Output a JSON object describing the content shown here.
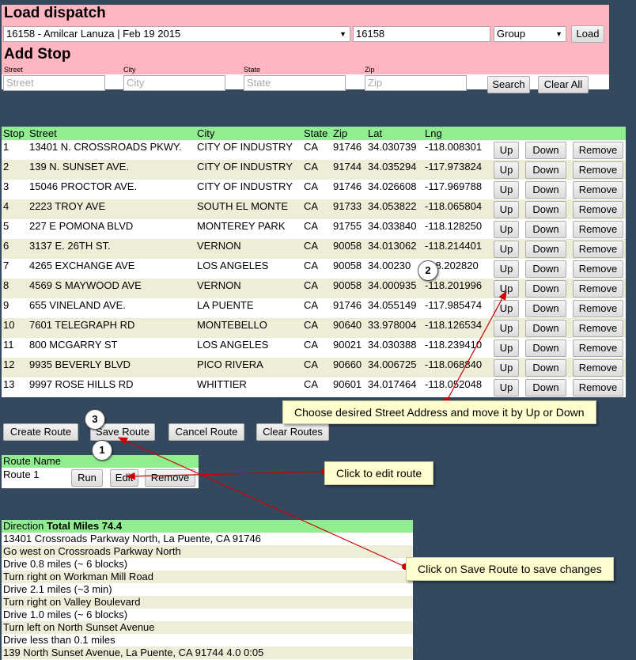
{
  "load_dispatch": {
    "title": "Load dispatch",
    "dispatch_select": "16158 - Amilcar Lanuza | Feb 19 2015",
    "dispatch_id": "16158",
    "group_select": "Group",
    "load_button": "Load"
  },
  "add_stop": {
    "title": "Add Stop",
    "labels": {
      "street": "Street",
      "city": "City",
      "state": "State",
      "zip": "Zip"
    },
    "placeholders": {
      "street": "Street",
      "city": "City",
      "state": "State",
      "zip": "Zip"
    },
    "search_button": "Search",
    "clear_all_button": "Clear All"
  },
  "stops": {
    "headers": [
      "Stop",
      "Street",
      "City",
      "State",
      "Zip",
      "Lat",
      "Lng"
    ],
    "buttons": {
      "up": "Up",
      "down": "Down",
      "remove": "Remove"
    },
    "rows": [
      [
        "1",
        "13401 N. CROSSROADS PKWY.",
        "CITY OF INDUSTRY",
        "CA",
        "91746",
        "34.030739",
        "-118.008301"
      ],
      [
        "2",
        "139 N. SUNSET AVE.",
        "CITY OF INDUSTRY",
        "CA",
        "91744",
        "34.035294",
        "-117.973824"
      ],
      [
        "3",
        "15046 PROCTOR AVE.",
        "CITY OF INDUSTRY",
        "CA",
        "91746",
        "34.026608",
        "-117.969788"
      ],
      [
        "4",
        "2223 TROY AVE",
        "SOUTH EL MONTE",
        "CA",
        "91733",
        "34.053822",
        "-118.065804"
      ],
      [
        "5",
        "227 E POMONA BLVD",
        "MONTEREY PARK",
        "CA",
        "91755",
        "34.033840",
        "-118.128250"
      ],
      [
        "6",
        "3137 E. 26TH ST.",
        "VERNON",
        "CA",
        "90058",
        "34.013062",
        "-118.214401"
      ],
      [
        "7",
        "4265 EXCHANGE AVE",
        "LOS ANGELES",
        "CA",
        "90058",
        "34.00230",
        "118.202820"
      ],
      [
        "8",
        "4569 S MAYWOOD AVE",
        "VERNON",
        "CA",
        "90058",
        "34.000935",
        "-118.201996"
      ],
      [
        "9",
        "655 VINELAND AVE.",
        "LA PUENTE",
        "CA",
        "91746",
        "34.055149",
        "-117.985474"
      ],
      [
        "10",
        "7601 TELEGRAPH RD",
        "MONTEBELLO",
        "CA",
        "90640",
        "33.978004",
        "-118.126534"
      ],
      [
        "11",
        "800 MCGARRY ST",
        "LOS ANGELES",
        "CA",
        "90021",
        "34.030388",
        "-118.239410"
      ],
      [
        "12",
        "9935 BEVERLY BLVD",
        "PICO RIVERA",
        "CA",
        "90660",
        "34.006725",
        "-118.068840"
      ],
      [
        "13",
        "9997 ROSE HILLS RD",
        "WHITTIER",
        "CA",
        "90601",
        "34.017464",
        "-118.052048"
      ]
    ]
  },
  "route_actions": {
    "create": "Create Route",
    "save": "Save Route",
    "cancel": "Cancel Route",
    "clear": "Clear Routes"
  },
  "routes": {
    "header": "Route Name",
    "items": [
      {
        "name": "Route 1",
        "run": "Run",
        "edit": "Edit",
        "remove": "Remove"
      }
    ]
  },
  "directions": {
    "header_label": "Direction",
    "total_miles": "Total Miles 74.4",
    "steps": [
      "13401 Crossroads Parkway North, La Puente, CA 91746",
      "Go west on Crossroads Parkway North",
      "Drive 0.8 miles (~ 6 blocks)",
      "Turn right on Workman Mill Road",
      "Drive 2.1 miles (~3 min)",
      "Turn right on Valley Boulevard",
      "Drive 1.0 miles (~ 6 blocks)",
      "Turn left on North Sunset Avenue",
      "Drive less than 0.1 miles",
      "139 North Sunset Avenue, La Puente, CA 91744 4.0 0:05"
    ]
  },
  "callouts": {
    "move": "Choose desired Street Address and move it by Up or Down",
    "edit": "Click to edit route",
    "save": "Click on Save Route to save changes"
  },
  "badges": {
    "one": "1",
    "two": "2",
    "three": "3"
  },
  "colors": {
    "background": "#34495e",
    "pink": "#ffb6c1",
    "green_header": "#90ee90",
    "row_alt": "#eeeed8",
    "callout": "#ffffd0",
    "arrow": "#cc0000"
  }
}
